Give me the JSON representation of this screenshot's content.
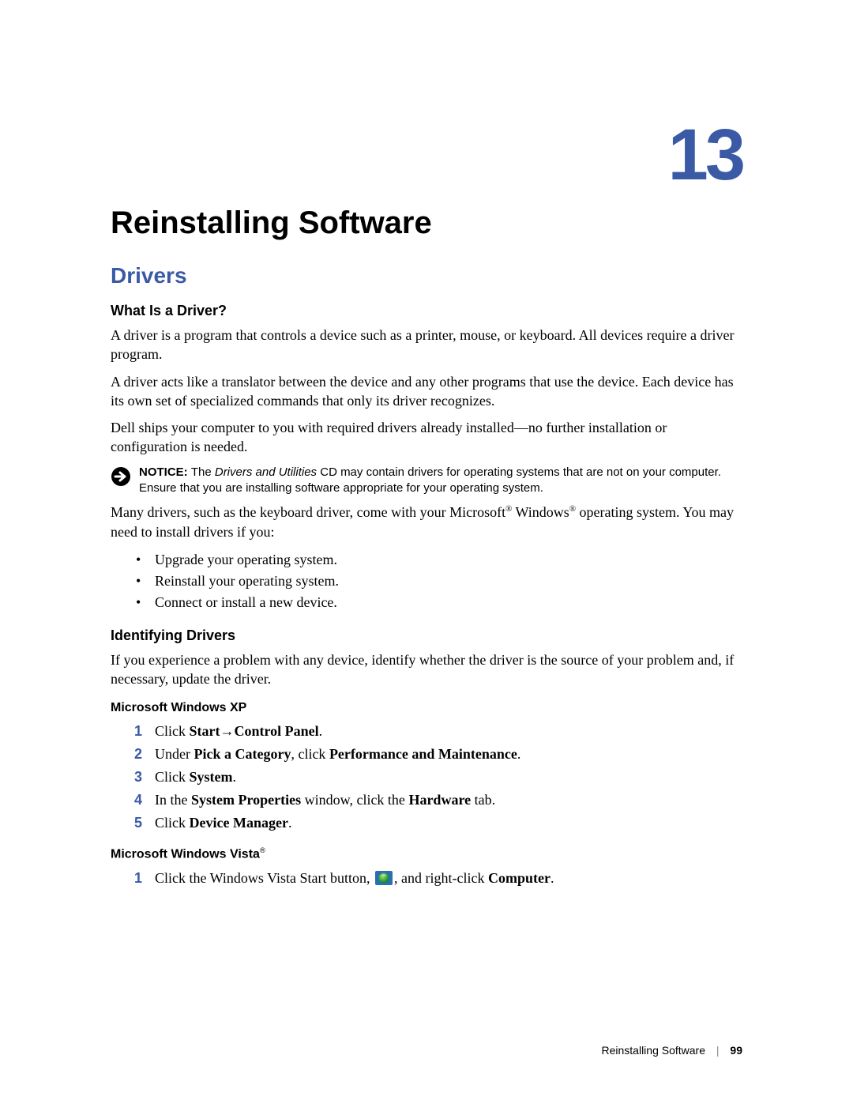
{
  "chapter": {
    "number": "13",
    "title": "Reinstalling Software"
  },
  "section": {
    "title": "Drivers"
  },
  "what_is": {
    "title": "What Is a Driver?",
    "p1": "A driver is a program that controls a device such as a printer, mouse, or keyboard. All devices require a driver program.",
    "p2": "A driver acts like a translator between the device and any other programs that use the device. Each device has its own set of specialized commands that only its driver recognizes.",
    "p3": "Dell ships your computer to you with required drivers already installed—no further installation or configuration is needed."
  },
  "notice": {
    "label": "NOTICE: ",
    "t1": "The ",
    "em": "Drivers and Utilities",
    "t2": " CD may contain drivers for operating systems that are not on your computer. Ensure that you are installing software appropriate for your operating system."
  },
  "many": {
    "t1": "Many drivers, such as the keyboard driver, come with your Microsoft",
    "t2": " Windows",
    "t3": " operating system. You may need to install drivers if you:"
  },
  "bullets": {
    "b1": "Upgrade your operating system.",
    "b2": "Reinstall your operating system.",
    "b3": "Connect or install a new device."
  },
  "identify": {
    "title": "Identifying Drivers",
    "p1": "If you experience a problem with any device, identify whether the driver is the source of your problem and, if necessary, update the driver."
  },
  "xp": {
    "title": "Microsoft Windows XP",
    "s1a": "Click ",
    "s1b": "Start",
    "s1arrow": "→",
    "s1c": "Control Panel",
    "s1d": ".",
    "s2a": "Under ",
    "s2b": "Pick a Category",
    "s2c": ", click ",
    "s2d": "Performance and Maintenance",
    "s2e": ".",
    "s3a": "Click ",
    "s3b": "System",
    "s3c": ".",
    "s4a": "In the ",
    "s4b": "System Properties",
    "s4c": " window, click the ",
    "s4d": "Hardware",
    "s4e": " tab.",
    "s5a": "Click ",
    "s5b": "Device Manager",
    "s5c": "."
  },
  "vista": {
    "title_a": "Microsoft Windows Vista",
    "s1a": "Click the Windows Vista Start button, ",
    "s1b": ", and right-click ",
    "s1c": "Computer",
    "s1d": "."
  },
  "footer": {
    "label": "Reinstalling Software",
    "page": "99"
  },
  "glyphs": {
    "reg": "®"
  }
}
